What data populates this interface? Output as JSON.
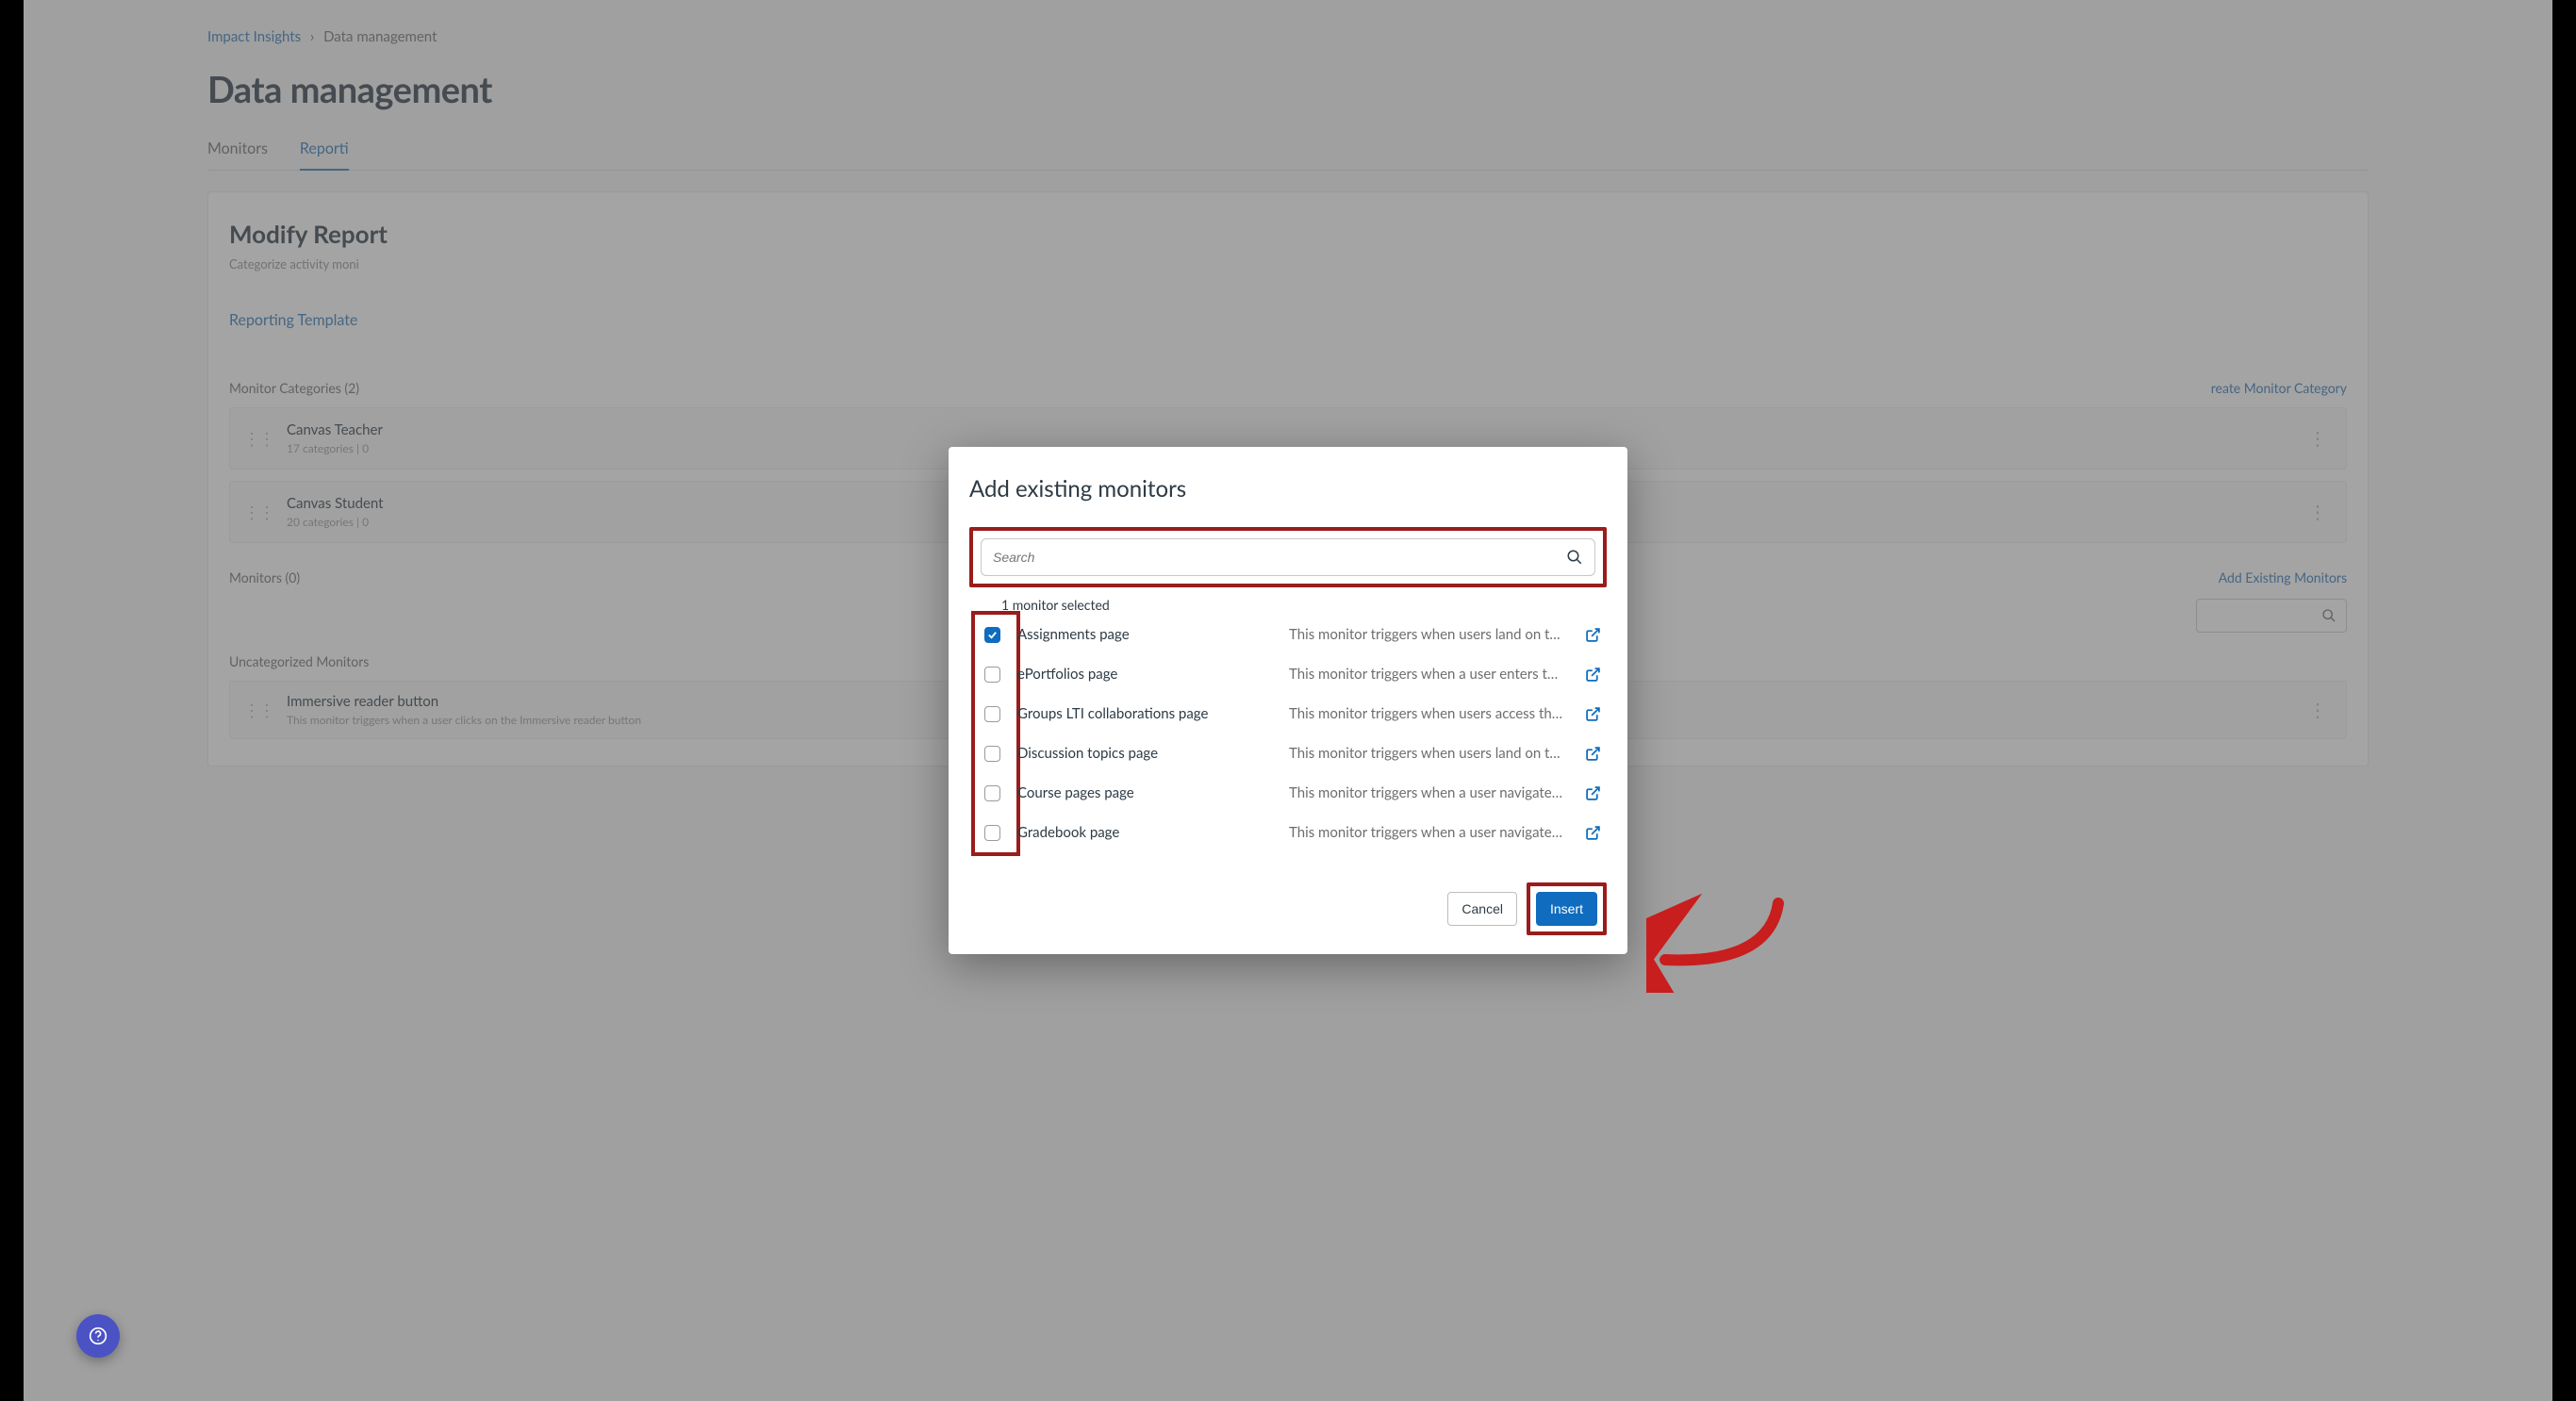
{
  "breadcrumb": {
    "root": "Impact Insights",
    "current": "Data management"
  },
  "page_title": "Data management",
  "tabs": [
    {
      "label": "Monitors",
      "active": false
    },
    {
      "label": "Reporti",
      "active": true
    }
  ],
  "panel": {
    "title": "Modify Report",
    "subtitle": "Categorize activity moni",
    "template_link": "Reporting Template",
    "categories_header": "Monitor Categories (2)",
    "create_category_link": "reate Monitor Category",
    "categories": [
      {
        "name": "Canvas Teacher",
        "meta": "17 categories   |   0"
      },
      {
        "name": "Canvas Student",
        "meta": "20 categories   |   0"
      }
    ],
    "monitors_header": "Monitors (0)",
    "add_existing_link": "Add Existing Monitors",
    "uncat_header": "Uncategorized Monitors",
    "uncat_item": {
      "name": "Immersive reader button",
      "desc": "This monitor triggers when a user clicks on the Immersive reader button"
    }
  },
  "modal": {
    "title": "Add existing monitors",
    "search_placeholder": "Search",
    "selected_text": "1 monitor selected",
    "rows": [
      {
        "name": "Assignments page",
        "desc": "This monitor triggers when users land on t…",
        "checked": true
      },
      {
        "name": "ePortfolios page",
        "desc": "This monitor triggers when a user enters t…",
        "checked": false
      },
      {
        "name": "Groups LTI collaborations page",
        "desc": "This monitor triggers when users access th…",
        "checked": false
      },
      {
        "name": "Discussion topics page",
        "desc": "This monitor triggers when users land on t…",
        "checked": false
      },
      {
        "name": "Course pages page",
        "desc": "This monitor triggers when a user navigate…",
        "checked": false
      },
      {
        "name": "Gradebook page",
        "desc": "This monitor triggers when a user navigate…",
        "checked": false
      }
    ],
    "cancel_label": "Cancel",
    "insert_label": "Insert"
  }
}
